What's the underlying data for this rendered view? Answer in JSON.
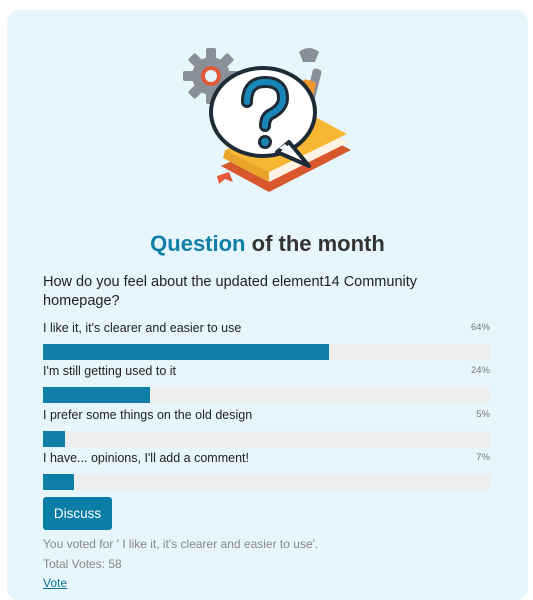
{
  "poll": {
    "title_accent": "Question",
    "title_rest": "of the month",
    "question": "How do you feel about the updated element14 Community homepage?",
    "options": [
      {
        "label": "I like it, it's clearer and easier to use",
        "percent_label": "64%",
        "fraction": 0.64
      },
      {
        "label": "I'm still getting used to it",
        "percent_label": "24%",
        "fraction": 0.24
      },
      {
        "label": "I prefer some things on the old design",
        "percent_label": "5%",
        "fraction": 0.05
      },
      {
        "label": "I have... opinions, I'll add a comment!",
        "percent_label": "7%",
        "fraction": 0.07
      }
    ],
    "discuss_label": "Discuss",
    "voted_text": "You voted for ' I like it, it's clearer and easier to use'.",
    "total_votes": "Total Votes: 58",
    "vote_link": "Vote"
  },
  "icons": {
    "illustration": "question-book-tools-illustration"
  },
  "colors": {
    "accent": "#0f7fa8",
    "card_background": "#e6f6fc",
    "bar_track": "#eeeeee",
    "button": "#0a7ea7"
  }
}
